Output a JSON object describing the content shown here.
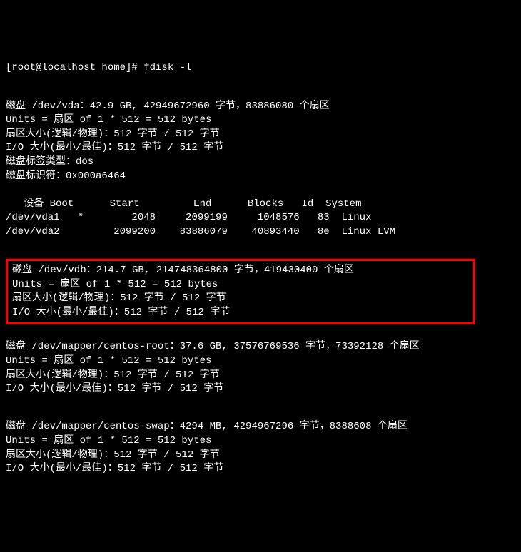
{
  "prompt": "[root@localhost home]# fdisk -l",
  "disk_vda": {
    "header": "磁盘 /dev/vda：42.9 GB, 42949672960 字节，83886080 个扇区",
    "units": "Units = 扇区 of 1 * 512 = 512 bytes",
    "sector_size": "扇区大小(逻辑/物理)：512 字节 / 512 字节",
    "io_size": "I/O 大小(最小/最佳)：512 字节 / 512 字节",
    "label_type": "磁盘标签类型：dos",
    "identifier": "磁盘标识符：0x000a6464",
    "table_header": "   设备 Boot      Start         End      Blocks   Id  System",
    "row1": "/dev/vda1   *        2048     2099199     1048576   83  Linux",
    "row2": "/dev/vda2         2099200    83886079    40893440   8e  Linux LVM"
  },
  "disk_vdb": {
    "header": "磁盘 /dev/vdb：214.7 GB, 214748364800 字节，419430400 个扇区",
    "units": "Units = 扇区 of 1 * 512 = 512 bytes",
    "sector_size": "扇区大小(逻辑/物理)：512 字节 / 512 字节",
    "io_size": "I/O 大小(最小/最佳)：512 字节 / 512 字节"
  },
  "disk_centos_root": {
    "header": "磁盘 /dev/mapper/centos-root：37.6 GB, 37576769536 字节，73392128 个扇区",
    "units": "Units = 扇区 of 1 * 512 = 512 bytes",
    "sector_size": "扇区大小(逻辑/物理)：512 字节 / 512 字节",
    "io_size": "I/O 大小(最小/最佳)：512 字节 / 512 字节"
  },
  "disk_centos_swap": {
    "header": "磁盘 /dev/mapper/centos-swap：4294 MB, 4294967296 字节，8388608 个扇区",
    "units": "Units = 扇区 of 1 * 512 = 512 bytes",
    "sector_size": "扇区大小(逻辑/物理)：512 字节 / 512 字节",
    "io_size": "I/O 大小(最小/最佳)：512 字节 / 512 字节"
  }
}
